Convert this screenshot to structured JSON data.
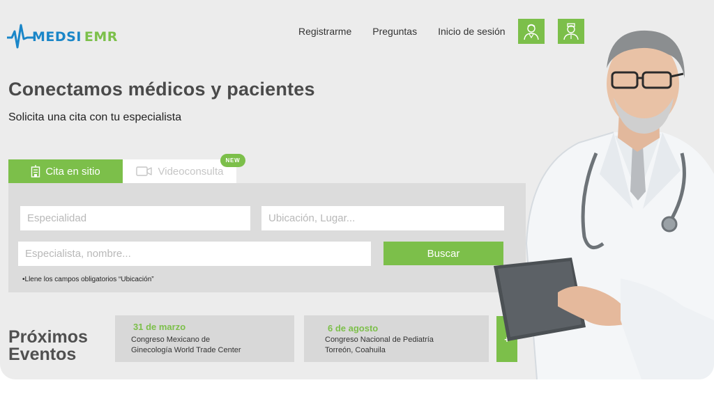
{
  "logo": {
    "name": "MEDSI",
    "suffix": "EMR"
  },
  "nav": {
    "links": [
      "Registrarme",
      "Preguntas",
      "Inicio de sesión"
    ],
    "icon_buttons": [
      "doctor-icon",
      "nurse-icon"
    ]
  },
  "hero": {
    "title": "Conectamos médicos y pacientes",
    "subtitle": "Solicita una cita con tu especialista"
  },
  "tabs": {
    "active": {
      "label": "Cita en sitio",
      "icon": "clinic-icon"
    },
    "inactive": {
      "label": "Videoconsulta",
      "icon": "video-camera-icon"
    },
    "badge": "NEW"
  },
  "search": {
    "especialidad_placeholder": "Especialidad",
    "ubicacion_placeholder": "Ubicación, Lugar...",
    "especialista_placeholder": "Especialista, nombre...",
    "button_label": "Buscar",
    "note": "•Llene los campos obligatorios “Ubicación”"
  },
  "events": {
    "title_line1": "Próximos",
    "title_line2": "Eventos",
    "items": [
      {
        "date": "31 de marzo",
        "line1": "Congreso Mexicano de",
        "line2": "Ginecología World Trade Center"
      },
      {
        "date": "6 de agosto",
        "line1": "Congreso Nacional de Pediatría",
        "line2": "Torreón, Coahuila"
      }
    ],
    "more_label": "+"
  },
  "colors": {
    "accent_green": "#7cbf4a",
    "logo_blue": "#1a86c8",
    "background": "#ececec",
    "panel": "#dcdcdc"
  }
}
